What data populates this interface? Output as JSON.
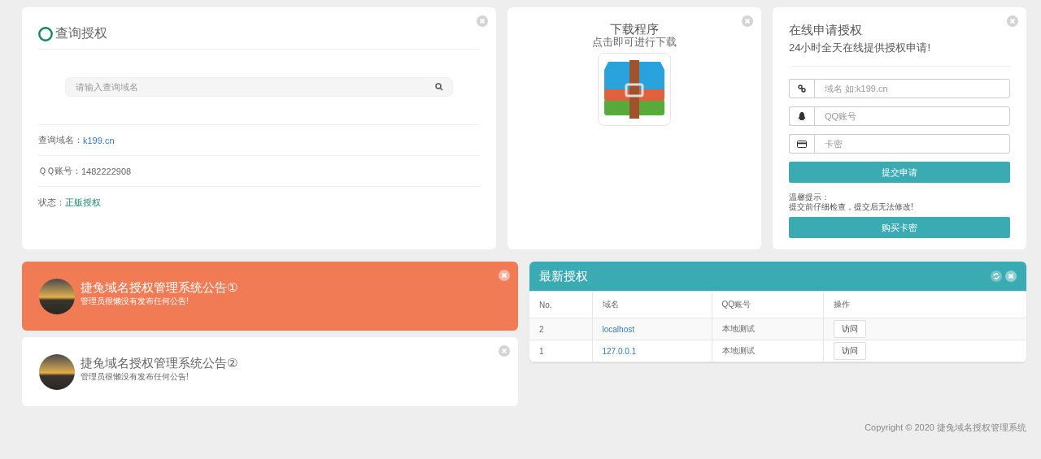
{
  "query": {
    "title": "查询授权",
    "search": {
      "placeholder": "请输入查询域名"
    },
    "fields": [
      {
        "label": "查询域名：",
        "value": "k199.cn",
        "kind": "link"
      },
      {
        "label": "ＱＱ账号：",
        "value": "1482222908",
        "kind": "plain"
      },
      {
        "label": "状态：",
        "value": "正版授权",
        "kind": "status"
      }
    ]
  },
  "download": {
    "title": "下载程序",
    "subtitle": "点击即可进行下载"
  },
  "apply": {
    "title": "在线申请授权",
    "subtitle": "24小时全天在线提供授权申请!",
    "inputs": [
      {
        "placeholder": "域名 如:k199.cn",
        "kind": "domain"
      },
      {
        "placeholder": "QQ账号",
        "kind": "qq"
      },
      {
        "placeholder": "卡密",
        "kind": "card"
      }
    ],
    "submit": "提交申请",
    "tip_title": "温馨提示：",
    "tip": "提交前仔细检查，提交后无法修改!",
    "buy": "购买卡密"
  },
  "notices": [
    {
      "title": "捷兔域名授权管理系统公告①",
      "text": "管理员很懒没有发布任何公告!",
      "highlighted": true
    },
    {
      "title": "捷兔域名授权管理系统公告②",
      "text": "管理员很懒没有发布任何公告!",
      "highlighted": false
    }
  ],
  "latest": {
    "title": "最新授权",
    "columns": [
      "No.",
      "域名",
      "QQ账号",
      "操作"
    ],
    "rows": [
      {
        "no": "2",
        "domain": "localhost",
        "qq": "本地测试",
        "action": "访问"
      },
      {
        "no": "1",
        "domain": "127.0.0.1",
        "qq": "本地测试",
        "action": "访问"
      }
    ]
  },
  "footer": "Copyright © 2020 捷兔域名授权管理系统"
}
